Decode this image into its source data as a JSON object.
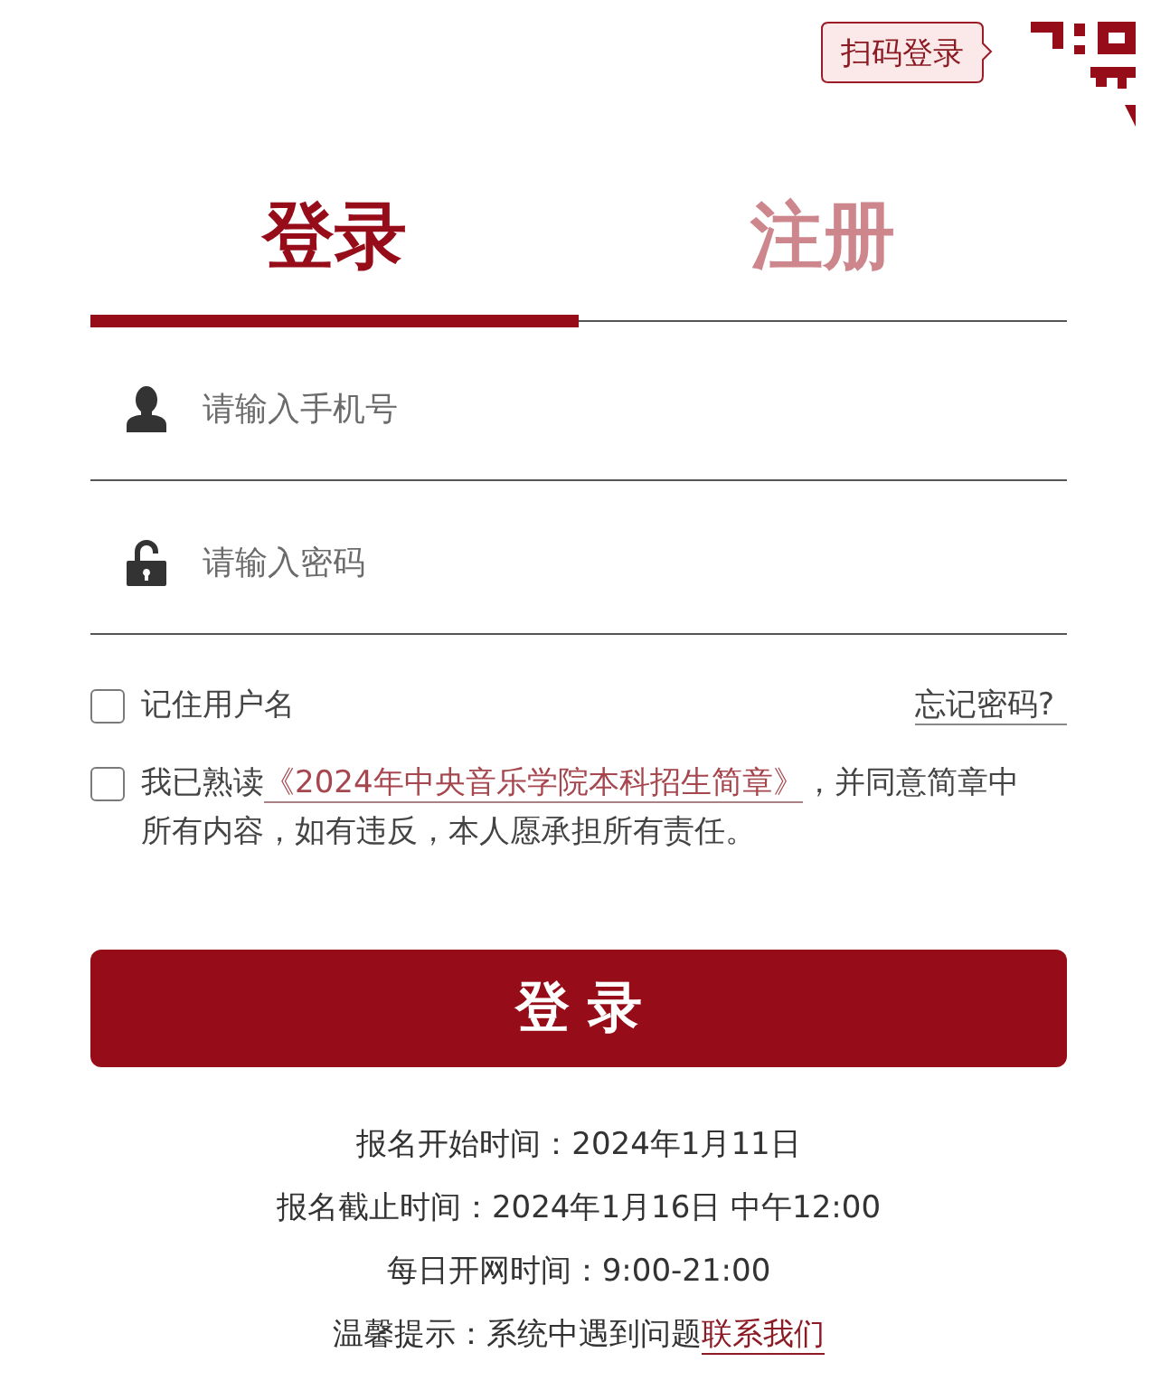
{
  "qr_login": {
    "label": "扫码登录"
  },
  "tabs": [
    {
      "label": "登录",
      "selected": true
    },
    {
      "label": "注册",
      "selected": false
    }
  ],
  "fields": [
    {
      "kind": "phone",
      "placeholder": "请输入手机号"
    },
    {
      "kind": "password",
      "placeholder": "请输入密码"
    }
  ],
  "remember": {
    "label": "记住用户名",
    "checked": false
  },
  "forgot_link": "忘记密码?",
  "agreement": {
    "checked": false,
    "before": "我已熟读",
    "link": "《2024年中央音乐学院本科招生简章》",
    "after": "，并同意简章中所有内容，如有违反，本人愿承担所有责任。"
  },
  "submit": {
    "label": "登 录"
  },
  "notices": [
    {
      "kind": "text",
      "text": "报名开始时间：2024年1月11日"
    },
    {
      "kind": "text",
      "text": "报名截止时间：2024年1月16日 中午12:00"
    },
    {
      "kind": "text",
      "text": "每日开网时间：9:00-21:00"
    },
    {
      "kind": "tip",
      "text": "温馨提示：系统中遇到问题",
      "link": "联系我们"
    }
  ]
}
